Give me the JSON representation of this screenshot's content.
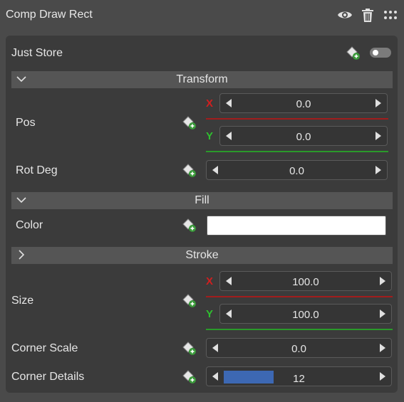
{
  "header": {
    "title": "Comp Draw Rect",
    "icons": [
      "eye-icon",
      "trash-icon",
      "grid-dots-icon"
    ]
  },
  "just_store": {
    "label": "Just Store",
    "enabled": false
  },
  "transform": {
    "title": "Transform",
    "pos": {
      "label": "Pos",
      "x_axis": "X",
      "x_value": "0.0",
      "y_axis": "Y",
      "y_value": "0.0"
    },
    "rot": {
      "label": "Rot Deg",
      "value": "0.0"
    }
  },
  "fill": {
    "title": "Fill",
    "color_label": "Color",
    "color_value": "#ffffff"
  },
  "stroke": {
    "title": "Stroke",
    "size": {
      "label": "Size",
      "x_axis": "X",
      "x_value": "100.0",
      "y_axis": "Y",
      "y_value": "100.0"
    },
    "corner_scale": {
      "label": "Corner Scale",
      "value": "0.0"
    },
    "corner_details": {
      "label": "Corner Details",
      "value": "12",
      "fill_fraction": 0.33
    }
  },
  "colors": {
    "x_axis": "#d11f1f",
    "y_axis": "#2fbf2f",
    "accent": "#3d68b3"
  }
}
